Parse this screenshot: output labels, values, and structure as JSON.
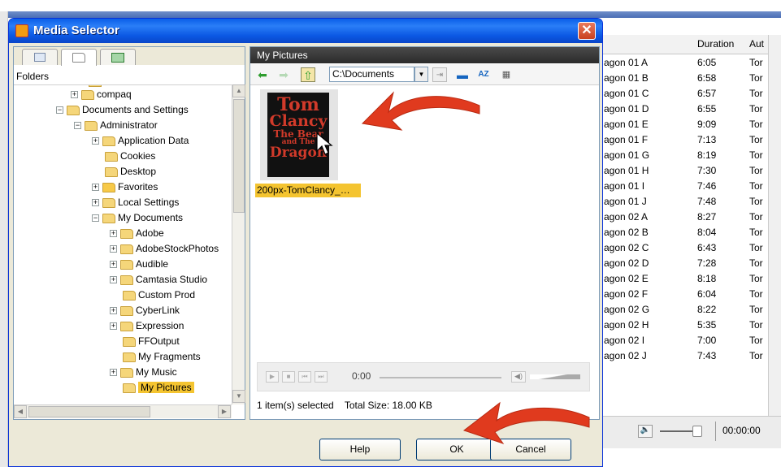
{
  "dialog": {
    "title": "Media Selector",
    "close_label": "✕",
    "tabs": [
      "folders-tab",
      "files-tab",
      "computer-tab"
    ],
    "folders_label": "Folders",
    "tree": [
      {
        "label": "compaq",
        "expander": "+"
      },
      {
        "label": "Documents and Settings",
        "expander": "−"
      },
      {
        "label": "Administrator",
        "expander": "−"
      },
      {
        "label": "Application Data",
        "expander": "+"
      },
      {
        "label": "Cookies",
        "expander": ""
      },
      {
        "label": "Desktop",
        "expander": ""
      },
      {
        "label": "Favorites",
        "expander": "+"
      },
      {
        "label": "Local Settings",
        "expander": "+"
      },
      {
        "label": "My Documents",
        "expander": "−"
      },
      {
        "label": "Adobe",
        "expander": "+"
      },
      {
        "label": "AdobeStockPhotos",
        "expander": "+"
      },
      {
        "label": "Audible",
        "expander": "+"
      },
      {
        "label": "Camtasia Studio",
        "expander": "+"
      },
      {
        "label": "Custom Prod",
        "expander": ""
      },
      {
        "label": "CyberLink",
        "expander": "+"
      },
      {
        "label": "Expression",
        "expander": "+"
      },
      {
        "label": "FFOutput",
        "expander": ""
      },
      {
        "label": "My Fragments",
        "expander": ""
      },
      {
        "label": "My Music",
        "expander": "+"
      },
      {
        "label": "My Pictures",
        "expander": ""
      }
    ],
    "right_panel": {
      "title": "My Pictures",
      "path": "C:\\Documents",
      "file": {
        "label": "200px-TomClancy_…",
        "cover_lines": [
          "Tom",
          "Clancy",
          "The Bear",
          "and The",
          "Dragon"
        ]
      },
      "player_time": "0:00",
      "status_selected": "1 item(s) selected",
      "status_size": "Total Size: 18.00 KB"
    },
    "buttons": {
      "help": "Help",
      "ok": "OK",
      "cancel": "Cancel"
    }
  },
  "background": {
    "columns": {
      "duration": "Duration",
      "author": "Aut"
    },
    "rows": [
      {
        "name": "agon 01 A",
        "duration": "6:05",
        "author": "Tor"
      },
      {
        "name": "agon 01 B",
        "duration": "6:58",
        "author": "Tor"
      },
      {
        "name": "agon 01 C",
        "duration": "6:57",
        "author": "Tor"
      },
      {
        "name": "agon 01 D",
        "duration": "6:55",
        "author": "Tor"
      },
      {
        "name": "agon 01 E",
        "duration": "9:09",
        "author": "Tor"
      },
      {
        "name": "agon 01 F",
        "duration": "7:13",
        "author": "Tor"
      },
      {
        "name": "agon 01 G",
        "duration": "8:19",
        "author": "Tor"
      },
      {
        "name": "agon 01 H",
        "duration": "7:30",
        "author": "Tor"
      },
      {
        "name": "agon 01 I",
        "duration": "7:46",
        "author": "Tor"
      },
      {
        "name": "agon 01 J",
        "duration": "7:48",
        "author": "Tor"
      },
      {
        "name": "agon 02 A",
        "duration": "8:27",
        "author": "Tor"
      },
      {
        "name": "agon 02 B",
        "duration": "8:04",
        "author": "Tor"
      },
      {
        "name": "agon 02 C",
        "duration": "6:43",
        "author": "Tor"
      },
      {
        "name": "agon 02 D",
        "duration": "7:28",
        "author": "Tor"
      },
      {
        "name": "agon 02 E",
        "duration": "8:18",
        "author": "Tor"
      },
      {
        "name": "agon 02 F",
        "duration": "6:04",
        "author": "Tor"
      },
      {
        "name": "agon 02 G",
        "duration": "8:22",
        "author": "Tor"
      },
      {
        "name": "agon 02 H",
        "duration": "5:35",
        "author": "Tor"
      },
      {
        "name": "agon 02 I",
        "duration": "7:00",
        "author": "Tor"
      },
      {
        "name": "agon 02 J",
        "duration": "7:43",
        "author": "Tor"
      }
    ],
    "player_time": "00:00:00"
  },
  "colors": {
    "accent": "#0a5ee8",
    "selection": "#f4c430",
    "arrow": "#e03a1e"
  }
}
